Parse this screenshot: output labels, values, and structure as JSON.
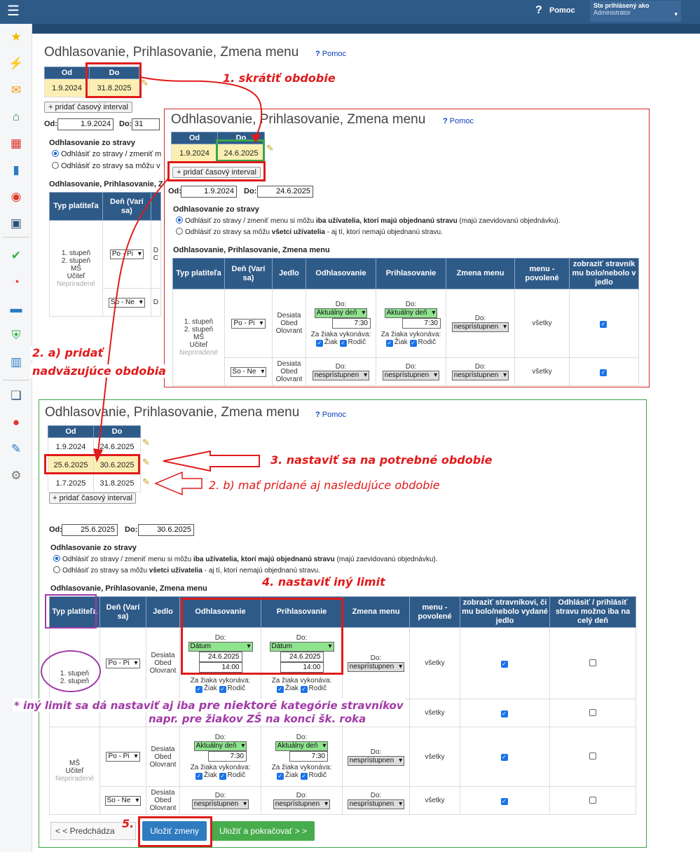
{
  "header": {
    "help": "Pomoc",
    "user_line1": "Ste prihlásený ako",
    "user_line2": "Administrátor"
  },
  "sidebar": {
    "icons": [
      "star-icon",
      "magic-wand-icon",
      "mail-icon",
      "home-icon",
      "calendar-grid-icon",
      "book-icon",
      "user-circle-icon",
      "calendar-icon",
      "check-circle-icon",
      "chart-pie-icon",
      "briefcase-icon",
      "shield-check-icon",
      "bar-chart-icon",
      "open-book-icon",
      "chat-icon",
      "feather-icon",
      "gear-icon"
    ]
  },
  "page": {
    "title": "Odhlasovanie, Prihlasovanie, Zmena menu",
    "help": "Pomoc"
  },
  "periods_header": {
    "od": "Od",
    "do": "Do"
  },
  "p1": {
    "rows": [
      {
        "od": "1.9.2024",
        "do": "31.8.2025"
      }
    ],
    "add_btn": "+ pridať časový interval",
    "od_label": "Od:",
    "od_val": "1.9.2024",
    "do_label": "Do:",
    "do_val": "31",
    "sec1": "Odhlasovanie zo stravy",
    "opt1": "Odhlásiť zo stravy / zmeniť m",
    "opt2": "Odhlásiť zo stravy sa môžu v",
    "sec2": "Odhlasovanie, Prihlasovanie, Z",
    "col_typ": "Typ platiteľa",
    "col_den": "Deň (Varí sa)",
    "typ1": "1. stupeň",
    "typ2": "2. stupeň",
    "typ3": "MŠ",
    "typ4": "Učiteľ",
    "typ5": "Nepriradené",
    "den1": "Po - Pi",
    "den2": "So - Ne",
    "cut1": "D",
    "cut2": "C",
    "cut3": "D"
  },
  "p2": {
    "rows": [
      {
        "od": "1.9.2024",
        "do": "24.6.2025"
      }
    ],
    "add_btn": "+ pridať časový interval",
    "od_label": "Od:",
    "od_val": "1.9.2024",
    "do_label": "Do:",
    "do_val": "24.6.2025",
    "sec1": "Odhlasovanie zo stravy",
    "opt1a": "Odhlásiť zo stravy / zmeniť menu si môžu ",
    "opt1b": "iba užívatelia, ktorí majú objednanú stravu",
    "opt1c": " (majú zaevidovanú objednávku).",
    "opt2a": "Odhlásiť zo stravy sa môžu ",
    "opt2b": "všetci užívatelia",
    "opt2c": " - aj tí, ktorí nemajú objednanú stravu.",
    "sec2": "Odhlasovanie, Prihlasovanie, Zmena menu",
    "cols": [
      "Typ platiteľa",
      "Deň (Varí sa)",
      "Jedlo",
      "Odhlasovanie",
      "Prihlasovanie",
      "Zmena menu",
      "menu - povolené",
      "zobraziť stravník mu bolo/nebolo v jedlo"
    ],
    "typ": [
      "1. stupeň",
      "2. stupeň",
      "MŠ",
      "Učiteľ",
      "Nepriradené"
    ],
    "den1": "Po - Pi",
    "den2": "So - Ne",
    "jedlo": [
      "Desiata",
      "Obed",
      "Olovrant"
    ],
    "do_lbl": "Do:",
    "aktualny": "Aktuálny deň",
    "time": "7:30",
    "za_ziaka": "Za žiaka vykonáva:",
    "ziak": "Žiak",
    "rodic": "Rodič",
    "nepristupne": "nesprístupnen",
    "vsetky": "všetky"
  },
  "p3": {
    "rows": [
      {
        "od": "1.9.2024",
        "do": "24.6.2025"
      },
      {
        "od": "25.6.2025",
        "do": "30.6.2025"
      },
      {
        "od": "1.7.2025",
        "do": "31.8.2025"
      }
    ],
    "add_btn": "+ pridať časový interval",
    "od_label": "Od:",
    "od_val": "25.6.2025",
    "do_label": "Do:",
    "do_val": "30.6.2025",
    "sec1": "Odhlasovanie zo stravy",
    "opt1a": "Odhlásiť zo stravy / zmeniť menu si môžu ",
    "opt1b": "iba užívatelia, ktorí majú objednanú stravu",
    "opt1c": " (majú zaevidovanú objednávku).",
    "opt2a": "Odhlásiť zo stravy sa môžu ",
    "opt2b": "všetci užívatelia",
    "opt2c": " - aj tí, ktorí nemajú objednanú stravu.",
    "sec2": "Odhlasovanie, Prihlasovanie, Zmena menu",
    "cols": [
      "Typ platiteľa",
      "Deň (Varí sa)",
      "Jedlo",
      "Odhlasovanie",
      "Prihlasovanie",
      "Zmena menu",
      "menu - povolené",
      "zobraziť stravníkovi, či mu bolo/nebolo vydané jedlo",
      "Odhlásiť / prihlásiť stravu možno iba na celý deň"
    ],
    "typA": [
      "1. stupeň",
      "2. stupeň"
    ],
    "typB": [
      "MŠ",
      "Učiteľ",
      "Nepriradené"
    ],
    "den1": "Po - Pi",
    "den2": "So - Ne",
    "jedlo": [
      "Desiata",
      "Obed",
      "Olovrant"
    ],
    "do_lbl": "Do:",
    "datum": "Dátum",
    "date_val": "24.6.2025",
    "time_val": "14:00",
    "aktualny": "Aktuálny deň",
    "time": "7:30",
    "za_ziaka": "Za žiaka vykonáva:",
    "ziak": "Žiak",
    "rodic": "Rodič",
    "nepristupne": "nesprístupnen",
    "vsetky": "všetky",
    "btn_prev": "< < Predchádza",
    "btn_save": "Uložiť zmeny",
    "btn_save_next": "Uložiť a pokračovať > >"
  },
  "notes": {
    "n1": "1.  skrátiť obdobie",
    "n2a": "2.  a)   pridať",
    "n2b": "nadväzujúce obdobia",
    "n3": "3.  nastaviť sa na potrebné obdobie",
    "n2c": "2.  b)   mať pridané aj nasledujúce obdobie",
    "n4": "4.   nastaviť iný limit",
    "n5": "5.",
    "p1a": "* iný limit sa dá nastaviť aj iba ",
    "p1b": "pre niektoré",
    "p1c": " kategórie stravníkov",
    "p2": "napr. pre žiakov ZŠ na konci šk. roka"
  },
  "colors": {
    "header": "#2e5a88",
    "annotation_red": "#e01b1b",
    "annotation_green": "#3aa64a",
    "annotation_purple": "#a23aa8",
    "highlight": "#fcefb4"
  }
}
